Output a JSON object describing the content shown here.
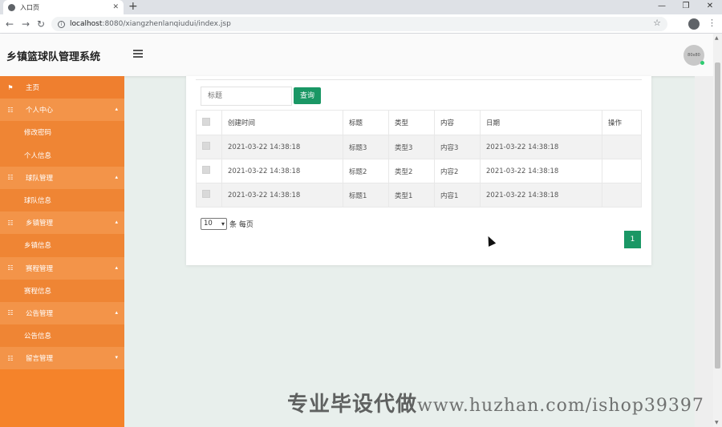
{
  "browser": {
    "tab_title": "入口页",
    "tab_close": "✕",
    "new_tab": "+",
    "win_min": "—",
    "win_max": "❐",
    "win_close": "✕",
    "back": "←",
    "forward": "→",
    "reload": "↻",
    "url_host": "localhost",
    "url_rest": ":8080/xiangzhenlanqiudui/index.jsp",
    "star": "☆",
    "menu": "⋮"
  },
  "header": {
    "title": "乡镇篮球队管理系统",
    "avatar_text": "80x80"
  },
  "sidebar": {
    "items": [
      {
        "label": "主页",
        "type": "home",
        "icon": "⚑"
      },
      {
        "label": "个人中心",
        "type": "group",
        "icon": "☷",
        "caret": "▴"
      },
      {
        "label": "修改密码",
        "type": "child"
      },
      {
        "label": "个人信息",
        "type": "child"
      },
      {
        "label": "球队管理",
        "type": "group",
        "icon": "☷",
        "caret": "▴"
      },
      {
        "label": "球队信息",
        "type": "child"
      },
      {
        "label": "乡镇管理",
        "type": "group",
        "icon": "☷",
        "caret": "▴"
      },
      {
        "label": "乡镇信息",
        "type": "child"
      },
      {
        "label": "赛程管理",
        "type": "group",
        "icon": "☷",
        "caret": "▴"
      },
      {
        "label": "赛程信息",
        "type": "child"
      },
      {
        "label": "公告管理",
        "type": "group",
        "icon": "☷",
        "caret": "▴"
      },
      {
        "label": "公告信息",
        "type": "child"
      },
      {
        "label": "留言管理",
        "type": "group",
        "icon": "☷",
        "caret": "▾"
      }
    ]
  },
  "search": {
    "placeholder": "标题",
    "button": "查询"
  },
  "table": {
    "headers": [
      "创建时间",
      "标题",
      "类型",
      "内容",
      "日期",
      "操作"
    ],
    "rows": [
      [
        "2021-03-22 14:38:18",
        "标题3",
        "类型3",
        "内容3",
        "2021-03-22 14:38:18",
        ""
      ],
      [
        "2021-03-22 14:38:18",
        "标题2",
        "类型2",
        "内容2",
        "2021-03-22 14:38:18",
        ""
      ],
      [
        "2021-03-22 14:38:18",
        "标题1",
        "类型1",
        "内容1",
        "2021-03-22 14:38:18",
        ""
      ]
    ]
  },
  "pagination": {
    "page_size": "10",
    "page_size_suffix": "条 每页",
    "current_page": "1"
  },
  "watermark": {
    "cn": "专业毕设代做",
    "url": "www.huzhan.com/ishop39397"
  },
  "colors": {
    "sidebar": "#f5832a",
    "accent": "#1a9765",
    "background": "#e8efec"
  }
}
